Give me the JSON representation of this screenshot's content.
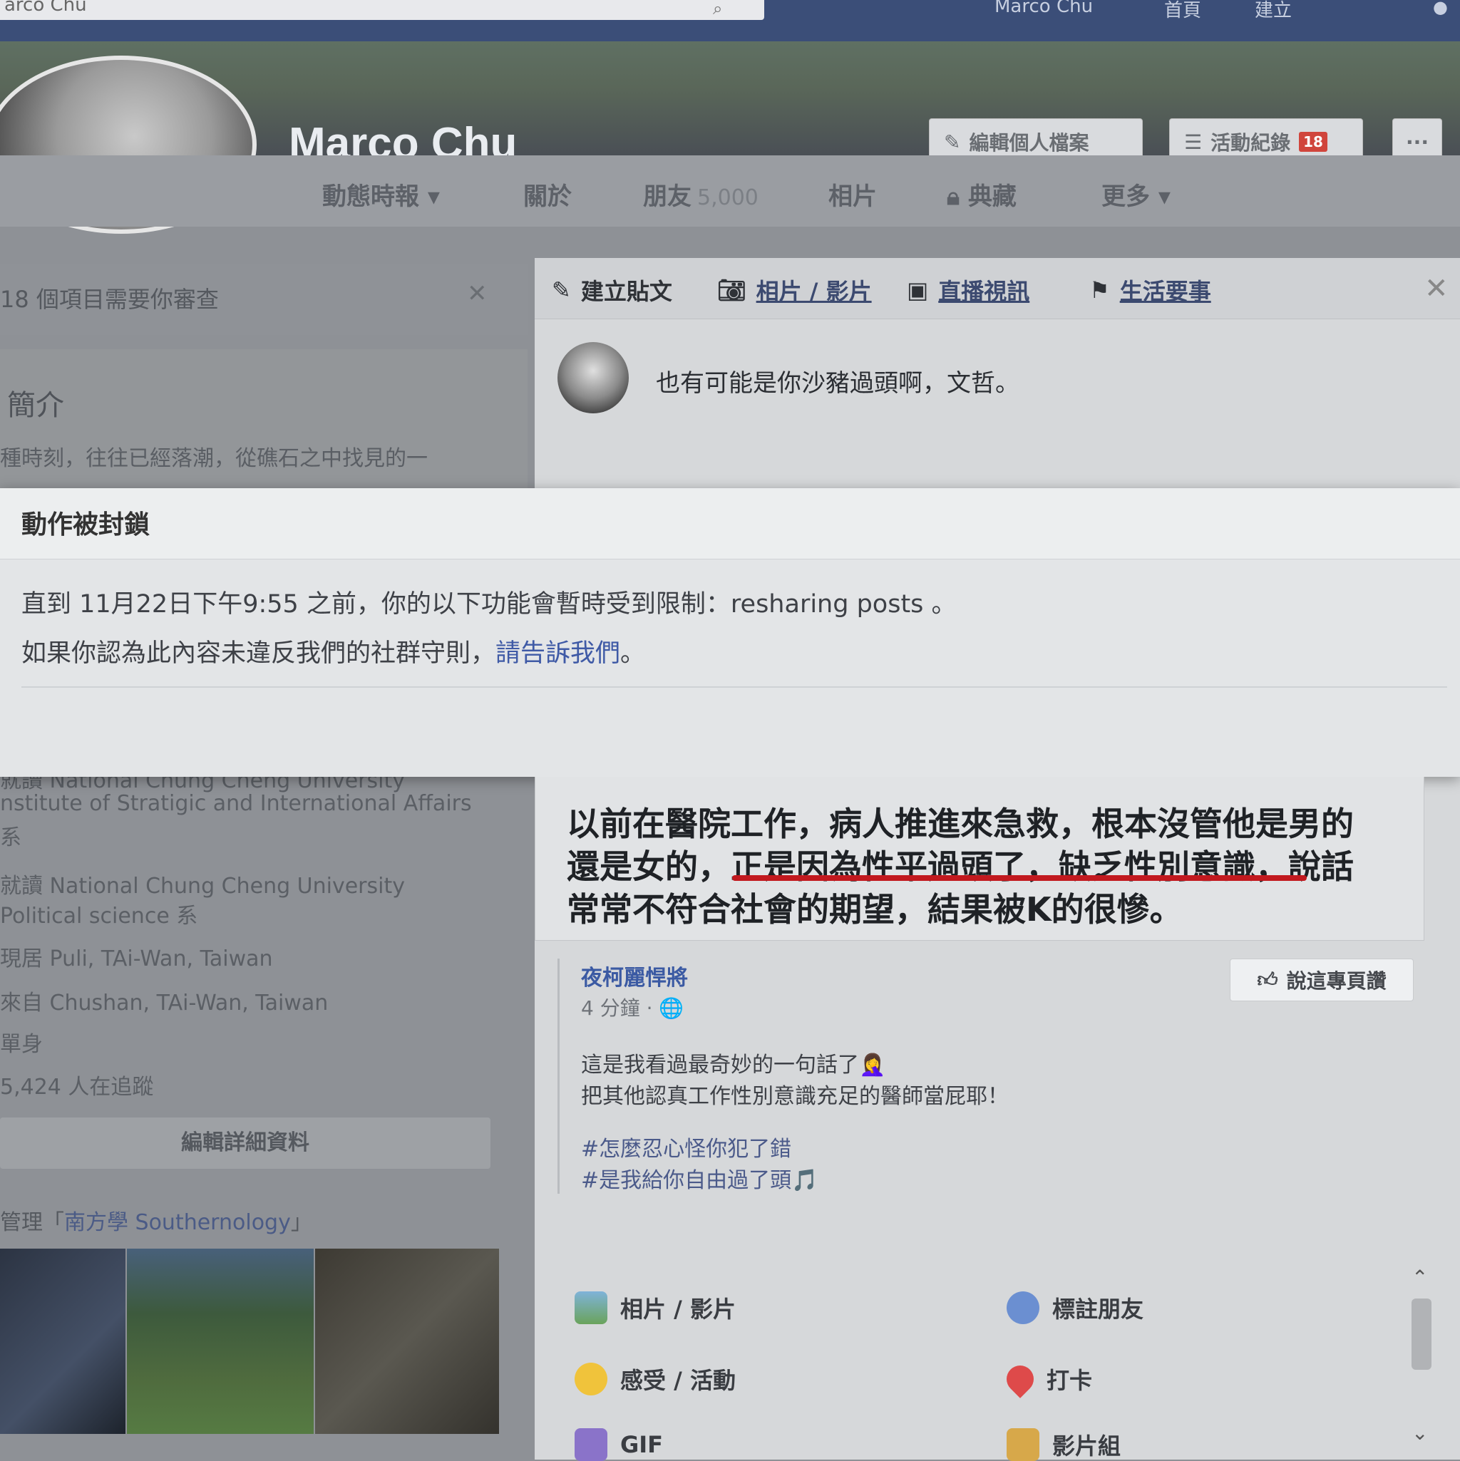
{
  "topbar": {
    "search_value": "arco Chu",
    "user_label": "Marco Chu",
    "home_label": "首頁",
    "create_label": "建立"
  },
  "profile": {
    "name": "Marco Chu",
    "edit_profile_label": "編輯個人檔案",
    "activity_log_label": "活動紀錄",
    "activity_log_count": "18",
    "more_label": "···"
  },
  "nav": {
    "timeline": "動態時報 ▾",
    "about": "關於",
    "friends": "朋友",
    "friends_count": "5,000",
    "photos": "相片",
    "archive": "典藏",
    "more": "更多 ▾"
  },
  "left": {
    "review_text": "18 個項目需要你審查",
    "intro_title": "簡介",
    "intro_text": "種時刻，往往已經落潮，從礁石之中找見的一",
    "info": [
      "就讀 National Chung Cheng University",
      "nstitute of Stratigic and International Affairs",
      "系",
      "就讀 National Chung Cheng University",
      "Political science 系",
      "現居 Puli, TAi-Wan, Taiwan",
      "來自 Chushan, TAi-Wan, Taiwan",
      "單身",
      "5,424 人在追蹤"
    ],
    "edit_details": "編輯詳細資料",
    "manage_prefix": "管理「",
    "manage_link": "南方學 Southernology",
    "manage_suffix": "」"
  },
  "composer": {
    "tabs": {
      "create_post": "建立貼文",
      "photo_video": "相片 / 影片",
      "live_video": "直播視訊",
      "life_event": "生活要事"
    },
    "text": "也有可能是你沙豬過頭啊，文哲。"
  },
  "blocked_dialog": {
    "title": "動作被封鎖",
    "line1": "直到 11月22日下午9:55 之前，你的以下功能會暫時受到限制：resharing posts 。",
    "line2_prefix": "如果你認為此內容未違反我們的社群守則，",
    "report_link": "請告訴我們",
    "line2_suffix": "。"
  },
  "quote": {
    "line1": "以前在醫院工作，病人推進來急救，根本沒管他是男的",
    "line2": "還是女的，正是因為性平過頭了，缺乏性別意識，說話",
    "line3": "常常不符合社會的期望，結果被K的很慘。"
  },
  "shared_post": {
    "page_name": "夜柯麗悍將",
    "time": "4 分鐘 · 🌐",
    "like_page": "說這專頁讚",
    "text1": "這是我看過最奇妙的一句話了🤦‍♀️",
    "text2": "把其他認真工作性別意識充足的醫師當屁耶！",
    "hashtag1": "#怎麼忍心怪你犯了錯",
    "hashtag2": "#是我給你自由過了頭🎵"
  },
  "options": {
    "photo_video": "相片 / 影片",
    "tag_friends": "標註朋友",
    "feeling": "感受 / 活動",
    "checkin": "打卡",
    "gif": "GIF",
    "watch_party": "影片組"
  }
}
